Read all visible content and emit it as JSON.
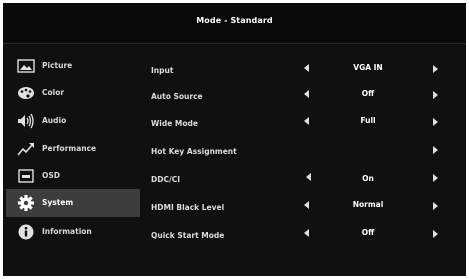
{
  "header": {
    "title": "Mode - Standard"
  },
  "sidebar": {
    "items": [
      {
        "label": "Picture",
        "icon": "picture-icon",
        "selected": false
      },
      {
        "label": "Color",
        "icon": "palette-icon",
        "selected": false
      },
      {
        "label": "Audio",
        "icon": "speaker-icon",
        "selected": false
      },
      {
        "label": "Performance",
        "icon": "trend-icon",
        "selected": false
      },
      {
        "label": "OSD",
        "icon": "osd-icon",
        "selected": false
      },
      {
        "label": "System",
        "icon": "gear-icon",
        "selected": true
      },
      {
        "label": "Information",
        "icon": "info-icon",
        "selected": false
      }
    ]
  },
  "settings": [
    {
      "name": "Input",
      "value": "VGA IN"
    },
    {
      "name": "Auto Source",
      "value": "Off"
    },
    {
      "name": "Wide Mode",
      "value": "Full"
    },
    {
      "name": "Hot Key Assignment",
      "value": ""
    },
    {
      "name": "DDC/CI",
      "value": "On"
    },
    {
      "name": "HDMI Black Level",
      "value": "Normal"
    },
    {
      "name": "Quick Start Mode",
      "value": "Off"
    }
  ]
}
